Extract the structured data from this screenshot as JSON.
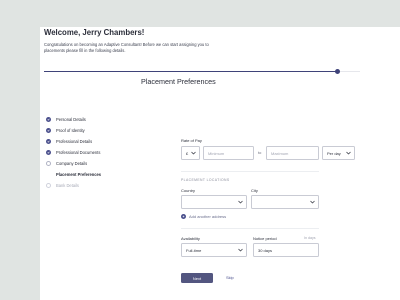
{
  "header": {
    "title": "Welcome, Jerry Chambers!",
    "subtitle": "Congratulations on becoming an Adaptive Consultant! Before we can start assigning you to placements please fill in the following details."
  },
  "progress": {
    "value": 0.93
  },
  "steps": [
    {
      "label": "Personal Details",
      "state": "done"
    },
    {
      "label": "Proof of Identity",
      "state": "done"
    },
    {
      "label": "Professional Details",
      "state": "done"
    },
    {
      "label": "Professional Documents",
      "state": "done"
    },
    {
      "label": "Company Details",
      "state": "current"
    },
    {
      "label": "Placement Preferences",
      "state": "active"
    },
    {
      "label": "Bank Details",
      "state": "pending"
    }
  ],
  "form": {
    "title": "Placement Preferences",
    "rate_label": "Rate of Pay",
    "currency": "£",
    "minimum_placeholder": "Minimum",
    "to_label": "to",
    "maximum_placeholder": "Maximum",
    "period": "Per day",
    "locations_label": "PLACEMENT LOCATIONS",
    "country_label": "Country",
    "city_label": "City",
    "add_address": "Add another address",
    "availability_label": "Availability",
    "availability_value": "Full-time",
    "notice_label": "Notice period",
    "notice_hint": "In days",
    "notice_value": "30 days"
  },
  "actions": {
    "next": "Next",
    "skip": "Skip"
  },
  "colors": {
    "accent": "#4a4f8c",
    "button": "#535680",
    "background": "#e0e4e2"
  }
}
